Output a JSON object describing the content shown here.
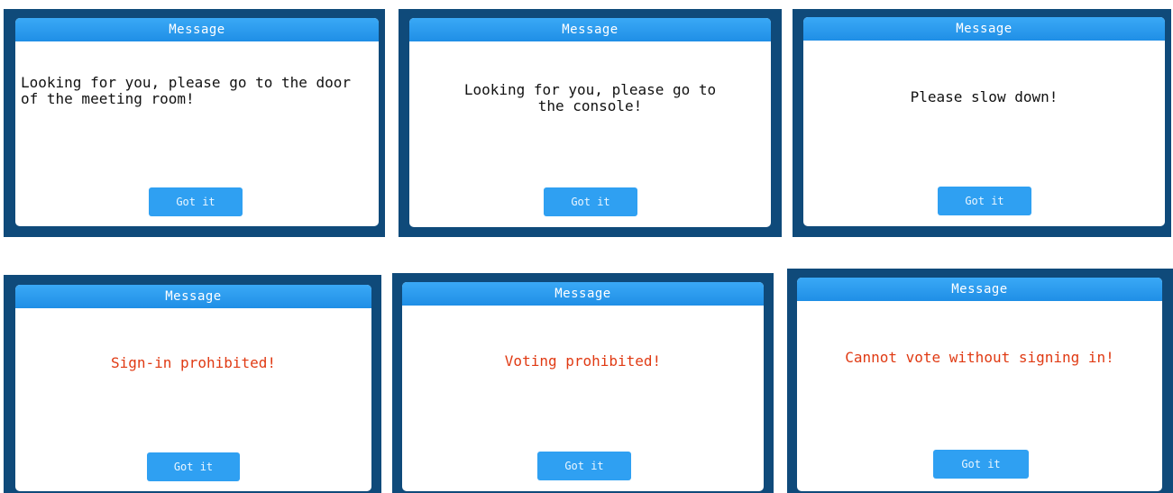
{
  "colors": {
    "frame": "#0f4a7a",
    "header": "#2b9cf0",
    "button": "#2fa0f2",
    "warning_text": "#e03a13",
    "normal_text": "#111111"
  },
  "dialogs": [
    {
      "title": "Message",
      "message": "Looking for you, please go to the door\nof the meeting room!",
      "button_label": "Got it"
    },
    {
      "title": "Message",
      "message": "Looking for you, please go to\nthe console!",
      "button_label": "Got it"
    },
    {
      "title": "Message",
      "message": "Please slow down!",
      "button_label": "Got it"
    },
    {
      "title": "Message",
      "message": "Sign-in prohibited!",
      "button_label": "Got it"
    },
    {
      "title": "Message",
      "message": "Voting prohibited!",
      "button_label": "Got it"
    },
    {
      "title": "Message",
      "message": "Cannot vote without signing in!",
      "button_label": "Got it"
    }
  ]
}
